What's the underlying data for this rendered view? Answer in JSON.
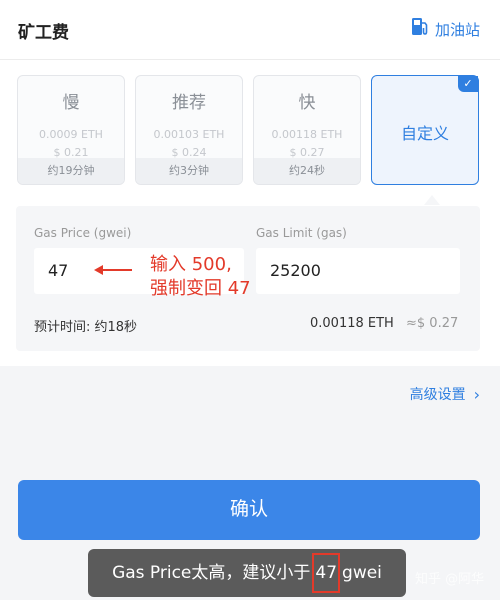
{
  "header": {
    "title": "矿工费",
    "gas_station_label": "加油站",
    "accent": "#2f7fe0"
  },
  "options": [
    {
      "name": "慢",
      "eth": "0.0009 ETH",
      "usd": "$ 0.21",
      "time": "约19分钟"
    },
    {
      "name": "推荐",
      "eth": "0.00103 ETH",
      "usd": "$ 0.24",
      "time": "约3分钟"
    },
    {
      "name": "快",
      "eth": "0.00118 ETH",
      "usd": "$ 0.27",
      "time": "约24秒"
    }
  ],
  "custom": {
    "label": "自定义",
    "check": "✓",
    "gas_price_label": "Gas Price (gwei)",
    "gas_price_value": "47",
    "gas_limit_label": "Gas Limit (gas)",
    "gas_limit_value": "25200",
    "est_time": "预计时间: 约18秒",
    "est_eth": "0.00118 ETH",
    "est_usd": "≈$ 0.27"
  },
  "annotation": {
    "line1": "输入 500,",
    "line2": "强制变回 47",
    "color": "#e33a2a"
  },
  "advanced_label": "高级设置",
  "confirm_label": "确认",
  "toast": {
    "prefix": "Gas Price太高，建议小于",
    "value": "47",
    "suffix": "gwei"
  },
  "watermark": "知乎 @阿华"
}
